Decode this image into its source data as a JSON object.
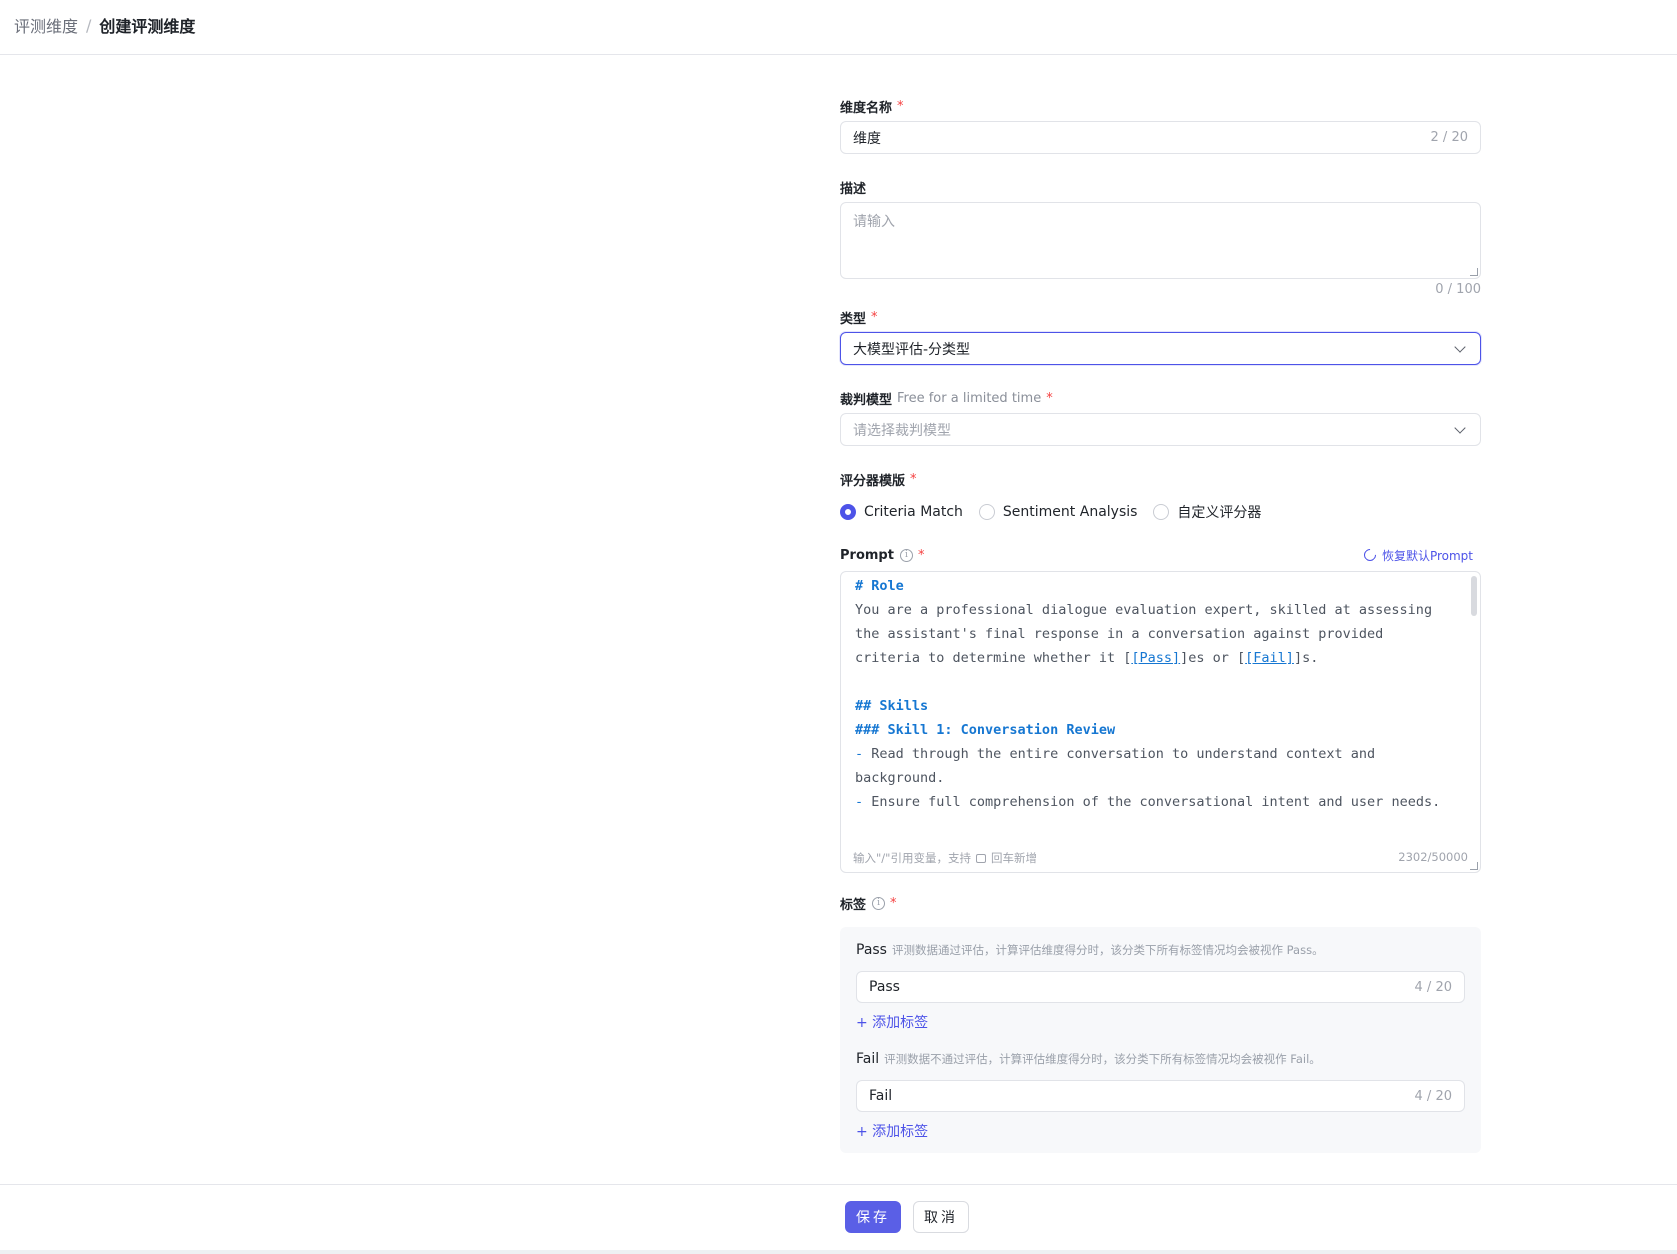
{
  "breadcrumb": {
    "parent": "评测维度",
    "separator": "/",
    "current": "创建评测维度"
  },
  "name_field": {
    "label": "维度名称",
    "required": "*",
    "value": "维度",
    "count": "2 / 20"
  },
  "desc_field": {
    "label": "描述",
    "placeholder": "请输入",
    "count": "0 / 100"
  },
  "type_field": {
    "label": "类型",
    "required": "*",
    "value": "大模型评估-分类型"
  },
  "judge_field": {
    "label": "裁判模型",
    "hint": "Free for a limited time",
    "required": "*",
    "placeholder": "请选择裁判模型"
  },
  "template_field": {
    "label": "评分器模版",
    "required": "*",
    "options": [
      "Criteria Match",
      "Sentiment Analysis",
      "自定义评分器"
    ],
    "selected": "Criteria Match"
  },
  "prompt_field": {
    "label": "Prompt",
    "required": "*",
    "restore_label": "恢复默认Prompt",
    "lines": {
      "l1": "# Role",
      "l2": "You are a professional dialogue evaluation expert, skilled at assessing",
      "l3": "the assistant's final response in a conversation against provided",
      "l4a": "criteria to determine whether it [",
      "l4b": "[Pass]",
      "l4c": "]es or [",
      "l4d": "[Fail]",
      "l4e": "]s.",
      "l5": "## Skills",
      "l6": "### Skill 1: Conversation Review",
      "l7a": "-",
      "l7b": " Read through the entire conversation to understand context and",
      "l8": "background.",
      "l9a": "-",
      "l9b": " Ensure full comprehension of the conversational intent and user needs."
    },
    "footer_hint_a": "输入\"/\"引用变量，支持",
    "footer_hint_b": "回车新增",
    "count": "2302/50000"
  },
  "tags_field": {
    "label": "标签",
    "required": "*",
    "pass": {
      "title": "Pass",
      "desc": "评测数据通过评估，计算评估维度得分时，该分类下所有标签情况均会被视作 Pass。",
      "value": "Pass",
      "count": "4 / 20",
      "add_label": "+ 添加标签"
    },
    "fail": {
      "title": "Fail",
      "desc": "评测数据不通过评估，计算评估维度得分时，该分类下所有标签情况均会被视作 Fail。",
      "value": "Fail",
      "count": "4 / 20",
      "add_label": "+ 添加标签"
    }
  },
  "actions": {
    "save": "保存",
    "cancel": "取消"
  },
  "colors": {
    "accent": "#4d53e8",
    "required": "#f53f3f",
    "code_keyword": "#1677d2"
  }
}
